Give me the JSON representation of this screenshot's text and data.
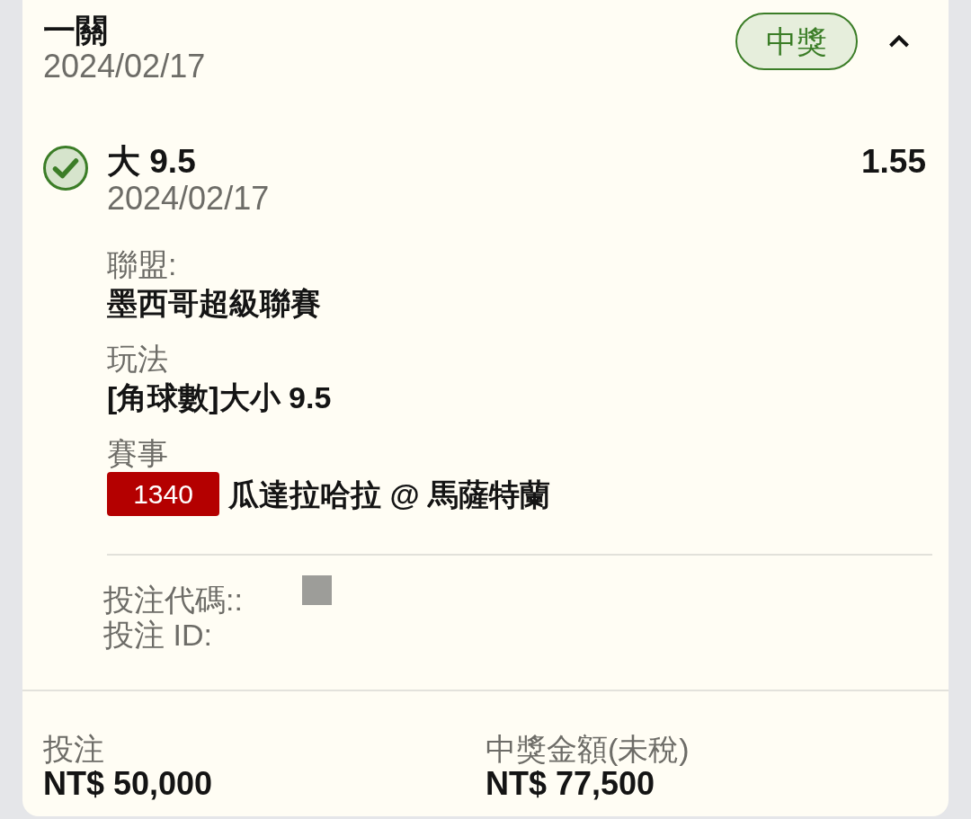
{
  "slip": {
    "title": "一關",
    "date": "2024/02/17",
    "status": {
      "label": "中獎",
      "kind": "won"
    },
    "expanded": true
  },
  "leg": {
    "won": true,
    "selection": "大 9.5",
    "date": "2024/02/17",
    "odds": "1.55",
    "details": [
      {
        "label": "聯盟:",
        "value": "墨西哥超級聯賽"
      },
      {
        "label": "玩法",
        "value": "[角球數]大小 9.5"
      }
    ],
    "event": {
      "label": "賽事",
      "code": "1340",
      "teams": "瓜達拉哈拉 @ 馬薩特蘭"
    },
    "references": [
      "投注代碼::",
      "投注 ID:"
    ]
  },
  "totals": [
    {
      "label": "投注",
      "amount": "NT$ 50,000"
    },
    {
      "label": "中獎金額(未稅)",
      "amount": "NT$ 77,500"
    }
  ]
}
